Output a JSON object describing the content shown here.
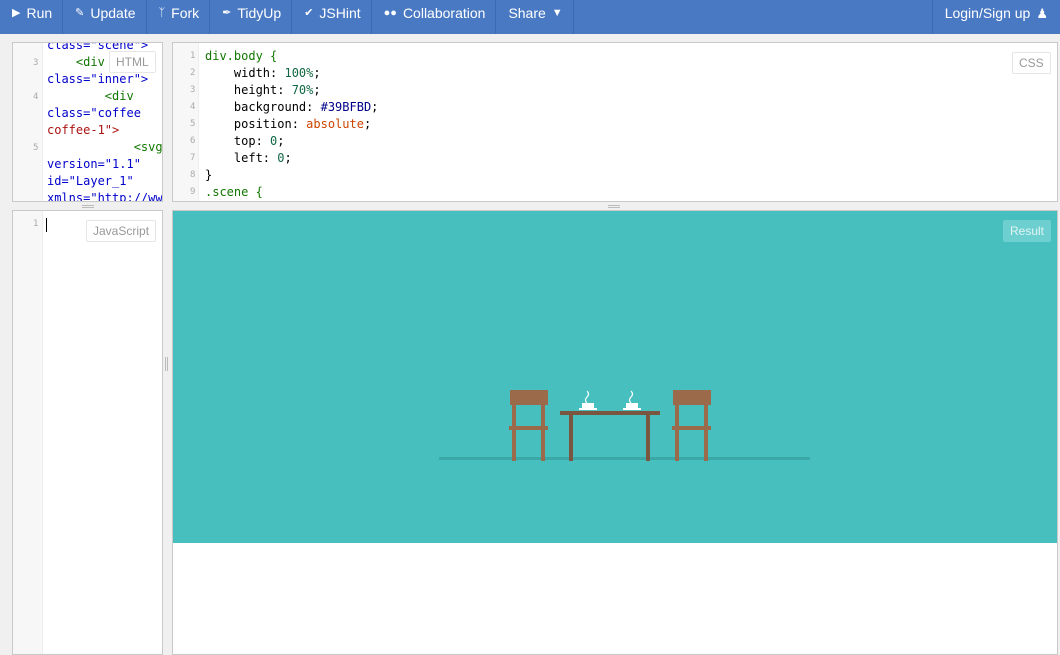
{
  "toolbar": {
    "run": "Run",
    "update": "Update",
    "fork": "Fork",
    "tidyup": "TidyUp",
    "jshint": "JSHint",
    "collaboration": "Collaboration",
    "share": "Share",
    "login": "Login/Sign up"
  },
  "html_panel": {
    "label": "HTML",
    "lines": [
      {
        "num": "",
        "text": "class=\"scene\">"
      },
      {
        "num": "3",
        "text": "    <div"
      },
      {
        "num": "",
        "text": "class=\"inner\">"
      },
      {
        "num": "4",
        "text": "        <div"
      },
      {
        "num": "",
        "text": "class=\"coffee"
      },
      {
        "num": "",
        "text": "coffee-1\">"
      },
      {
        "num": "5",
        "text": "            <svg"
      },
      {
        "num": "",
        "text": "version=\"1.1\""
      },
      {
        "num": "",
        "text": "id=\"Layer_1\""
      },
      {
        "num": "",
        "text": "xmlns=\"http://ww"
      }
    ]
  },
  "css_panel": {
    "label": "CSS",
    "line_numbers": [
      "1",
      "2",
      "3",
      "4",
      "5",
      "6",
      "7",
      "8",
      "9"
    ],
    "lines": [
      "div.body {",
      "    width: 100%;",
      "    height: 70%;",
      "    background: #39BFBD;",
      "    position: absolute;",
      "    top: 0;",
      "    left: 0;",
      "}",
      ".scene {"
    ]
  },
  "js_panel": {
    "label": "JavaScript",
    "line_numbers": [
      "1"
    ]
  },
  "result_panel": {
    "label": "Result"
  },
  "colors": {
    "toolbar": "#4a79c4",
    "scene": "#48bfbf",
    "furniture": "#9a6a4a",
    "floor": "#3aa8a6",
    "cup": "#ffffff"
  }
}
